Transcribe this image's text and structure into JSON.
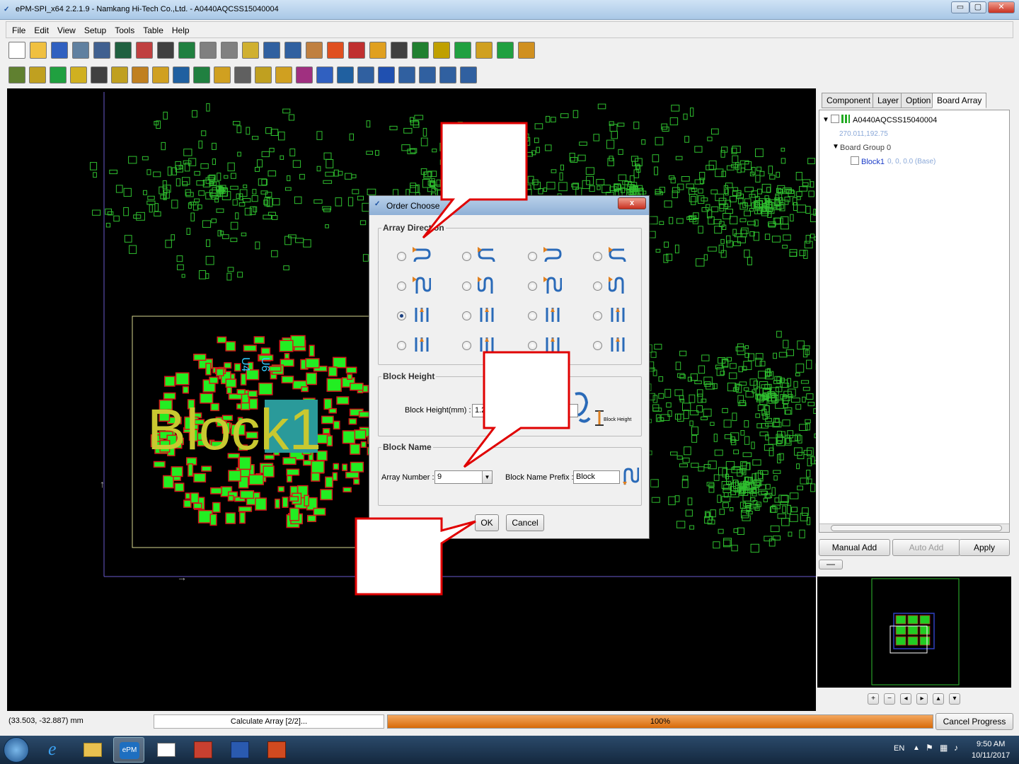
{
  "window": {
    "title": "ePM-SPI_x64 2.2.1.9 - Namkang Hi-Tech Co.,Ltd. - A0440AQCSS15040004",
    "minimize": "▭",
    "restore": "▢",
    "close": "✕"
  },
  "menu": [
    "File",
    "Edit",
    "View",
    "Setup",
    "Tools",
    "Table",
    "Help"
  ],
  "canvas": {
    "block_label": "Block1",
    "comp_u4": "U4",
    "comp_u6": "U6"
  },
  "right_panel": {
    "tabs": [
      "Component",
      "Layer",
      "Option",
      "Board Array"
    ],
    "active_tab": "Board Array",
    "tree": {
      "root": "A0440AQCSS15040004",
      "root_coords": "270.011,192.75",
      "group": "Board Group 0",
      "block": "Block1",
      "block_info": "0, 0, 0.0 (Base)"
    },
    "buttons": {
      "manual_add": "Manual Add",
      "auto_add": "Auto Add",
      "apply": "Apply",
      "minus": "—"
    },
    "map_controls": [
      "+",
      "−",
      "◂",
      "▸",
      "▴",
      "▾"
    ]
  },
  "dialog": {
    "title": "Order Choose",
    "close": "x",
    "array_direction_label": "Array Direction",
    "selected_option_index": 8,
    "block_height_label": "Block Height",
    "block_height_field_label": "Block Height(mm) :",
    "block_height_value": "1.2",
    "block_height_diagram": "Block Height",
    "block_name_label": "Block Name",
    "array_number_label": "Array Number :",
    "array_number_value": "9",
    "block_name_prefix_label": "Block Name Prefix :",
    "block_name_prefix_value": "Block",
    "ok": "OK",
    "cancel": "Cancel"
  },
  "status": {
    "coordinates": "(33.503, -32.887) mm",
    "task": "Calculate Array [2/2]...",
    "progress_text": "100%",
    "progress_fraction": 1.0,
    "cancel": "Cancel Progress"
  },
  "taskbar": {
    "lang": "EN",
    "time": "9:50 AM",
    "date": "10/11/2017",
    "epm_label": "ePM"
  },
  "colors": {
    "accent": "#e00000",
    "pcb_green": "#2fbf2f",
    "pad_green": "#22ee22",
    "pad_red": "#d41818",
    "progress": "#e07a10"
  }
}
